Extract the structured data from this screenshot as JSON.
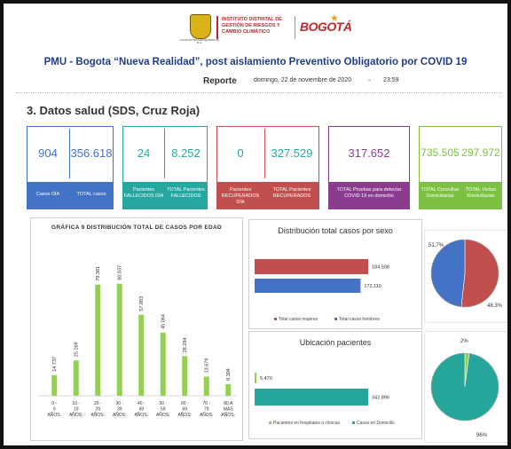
{
  "header": {
    "crest_text": "ALCALDÍA MAYOR DE BOGOTÁ D.C.",
    "idiger_text": "INSTITUTO DISTRITAL DE GESTIÓN DE RIESGOS Y CAMBIO CLIMÁTICO",
    "bogota_logo": "BOGOTÁ",
    "title": "PMU - Bogota “Nueva Realidad”, post  aislamiento Preventivo Obligatorio por COVID 19",
    "reporte_label": "Reporte",
    "reporte_date": "domingo, 22 de noviembre de 2020",
    "reporte_sep": "-",
    "reporte_time": "23:59"
  },
  "section_title": "3. Datos salud (SDS, Cruz Roja)",
  "kpis": {
    "casos_dia": {
      "value": "904",
      "label": "Casos DÍA"
    },
    "total_casos": {
      "value": "356.618",
      "label": "TOTAL casos"
    },
    "fallecidos_dia": {
      "value": "24",
      "label": "Pacientes FALLECIDOS DÍA"
    },
    "total_fallecidos": {
      "value": "8.252",
      "label": "TOTAL Pacientes FALLECIDOS"
    },
    "recuperados_dia": {
      "value": "0",
      "label": "Pacientes RECUPERADOS DÍA"
    },
    "total_recuperados": {
      "value": "327.529",
      "label": "TOTAL Pacientes RECUPERADOS"
    },
    "pruebas": {
      "value": "317.652",
      "label": "TOTAL Pruebas para detectar COVID 19 en domicilio"
    },
    "consultas": {
      "value": "735.505",
      "label": "TOTAL Consultas Domiciliarias"
    },
    "visitas": {
      "value": "297.972",
      "label": "TOTAL Visitas Domiciliarias"
    }
  },
  "colors": {
    "blue": "#4472c4",
    "teal": "#27a6a0",
    "red": "#c0504d",
    "purple": "#8b3c8f",
    "green": "#7cc142",
    "bar_green": "#92d050",
    "men_blue": "#4472c4",
    "women_red": "#c0504d",
    "hospital_green": "#92d050",
    "home_teal": "#26a69a"
  },
  "chart_data": [
    {
      "type": "bar",
      "title": "GRÁFICA 9 DISTRIBUCIÓN TOTAL DE CASOS POR EDAD",
      "categories": [
        "0 - 9 AÑOS:",
        "10 - 19 AÑOS:",
        "20 - 29 AÑOS:",
        "30 - 39 AÑOS:",
        "40 - 49 AÑOS:",
        "50 - 59 AÑOS:",
        "60 - 69 AÑOS:",
        "70 - 79 AÑOS:",
        "80 A MAS AÑOS:"
      ],
      "values": [
        14737,
        25169,
        79381,
        80037,
        57883,
        45064,
        28284,
        13679,
        8304
      ],
      "value_labels": [
        "14.737",
        "25.169",
        "79.381",
        "80.037",
        "57.883",
        "45.064",
        "28.284",
        "13.679",
        "8.304"
      ]
    },
    {
      "type": "bar",
      "title": "Distribución total casos por sexo",
      "orientation": "horizontal",
      "categories": [
        "Total casos mujeres",
        "Total casos hombres"
      ],
      "values": [
        184508,
        172110
      ],
      "value_labels": [
        "184.508",
        "172.110"
      ]
    },
    {
      "type": "pie",
      "labels": [
        "Total casos mujeres",
        "Total casos hombres"
      ],
      "values": [
        51.7,
        48.3
      ],
      "value_labels": [
        "51,7%",
        "48,3%"
      ]
    },
    {
      "type": "bar",
      "title": "Ubicación pacientes",
      "orientation": "horizontal",
      "categories": [
        "Pacientes en hospitales o clínicas",
        "Casos en Domicilio"
      ],
      "values": [
        5470,
        342896
      ],
      "value_labels": [
        "5.470",
        "342.896"
      ]
    },
    {
      "type": "pie",
      "labels": [
        "Pacientes en hospitales o clínicas",
        "Casos en Domicilio"
      ],
      "values": [
        2,
        96
      ],
      "value_labels": [
        "2%",
        "96%"
      ]
    }
  ]
}
